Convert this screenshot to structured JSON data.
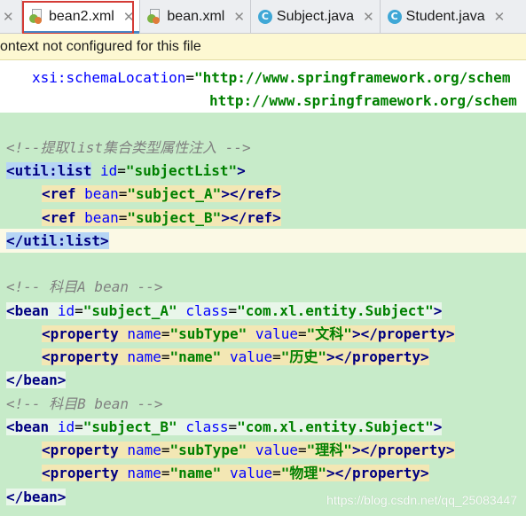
{
  "tabs": [
    {
      "name": "bean2.xml",
      "type": "xml",
      "active": true
    },
    {
      "name": "bean.xml",
      "type": "xml",
      "active": false
    },
    {
      "name": "Subject.java",
      "type": "java",
      "active": false
    },
    {
      "name": "Student.java",
      "type": "java",
      "active": false
    }
  ],
  "tab_close_glyph": "✕",
  "java_icon_letter": "C",
  "notice_text": "ontext not configured for this file",
  "code": {
    "l1_attr": "xsi:schemaLocation",
    "l1_eq": "=",
    "l1_str": "\"http://www.springframework.org/schem",
    "l2_str": "http://www.springframework.org/schem",
    "c1": "<!--提取list集合类型属性注入 -->",
    "util_open_tag": "<util:list",
    "util_id_attr": "id",
    "util_id_val": "\"subjectList\"",
    "util_gt": ">",
    "ref1_tag": "<ref",
    "ref1_attr": "bean",
    "ref1_val": "\"subject_A\"",
    "ref1_close": "></ref>",
    "ref2_tag": "<ref",
    "ref2_attr": "bean",
    "ref2_val": "\"subject_B\"",
    "ref2_close": "></ref>",
    "util_close": "</util:list>",
    "c2": "<!-- 科目A bean -->",
    "beanA_tag": "<bean",
    "beanA_id_attr": "id",
    "beanA_id_val": "\"subject_A\"",
    "beanA_class_attr": "class",
    "beanA_class_val": "\"com.xl.entity.Subject\"",
    "beanA_gt": ">",
    "pA1_tag": "<property",
    "pA1_name_attr": "name",
    "pA1_name_val": "\"subType\"",
    "pA1_value_attr": "value",
    "pA1_value_val": "\"文科\"",
    "pA1_close": "></property>",
    "pA2_tag": "<property",
    "pA2_name_attr": "name",
    "pA2_name_val": "\"name\"",
    "pA2_value_attr": "value",
    "pA2_value_val": "\"历史\"",
    "pA2_close": "></property>",
    "beanA_end": "</bean>",
    "c3": "<!-- 科目B bean -->",
    "beanB_tag": "<bean",
    "beanB_id_attr": "id",
    "beanB_id_val": "\"subject_B\"",
    "beanB_class_attr": "class",
    "beanB_class_val": "\"com.xl.entity.Subject\"",
    "beanB_gt": ">",
    "pB1_tag": "<property",
    "pB1_name_attr": "name",
    "pB1_name_val": "\"subType\"",
    "pB1_value_attr": "value",
    "pB1_value_val": "\"理科\"",
    "pB1_close": "></property>",
    "pB2_tag": "<property",
    "pB2_name_attr": "name",
    "pB2_name_val": "\"name\"",
    "pB2_value_attr": "value",
    "pB2_value_val": "\"物理\"",
    "pB2_close": "></property>",
    "beanB_end": "</bean>"
  },
  "watermark": "https://blog.csdn.net/qq_25083447",
  "colors": {
    "editor_bg": "#c7ebc9",
    "tag": "#000080",
    "attribute": "#0000ff",
    "string": "#008000",
    "comment": "#808080",
    "tab_highlight_box": "#d43b36"
  }
}
